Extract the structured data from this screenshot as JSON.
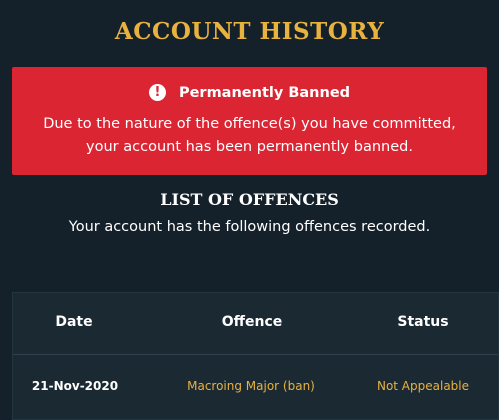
{
  "colors": {
    "background": "#14202a",
    "accent_gold": "#e8b23e",
    "alert_red": "#db2533",
    "table_bg": "#1b2933"
  },
  "header": {
    "title": "ACCOUNT HISTORY"
  },
  "ban_alert": {
    "icon": "exclamation-circle-icon",
    "icon_glyph": "!",
    "heading": "Permanently Banned",
    "line1": "Due to the nature of the offence(s) you have committed,",
    "line2": "your account has been permanently banned."
  },
  "offences": {
    "title": "LIST OF OFFENCES",
    "subtitle": "Your account has the following offences recorded.",
    "columns": {
      "date": "Date",
      "offence": "Offence",
      "status": "Status"
    },
    "rows": [
      {
        "date": "21-Nov-2020",
        "offence": "Macroing Major (ban)",
        "status": "Not Appealable"
      }
    ]
  }
}
